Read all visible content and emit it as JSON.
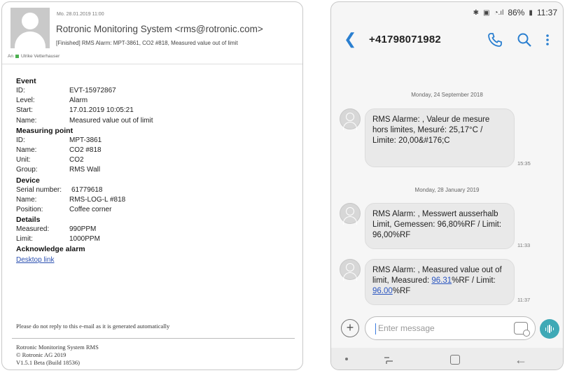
{
  "email": {
    "date": "Mo. 28.01.2019 11:00",
    "sender": "Rotronic Monitoring System <rms@rotronic.com>",
    "subject": "[Finished] RMS Alarm: MPT-3861, CO2 #818, Measured value out of limit",
    "to_prefix": "An",
    "to_name": "Ulrike Vetterhauser",
    "sections": [
      {
        "title": "Event",
        "rows": [
          {
            "k": "ID:",
            "v": "EVT-15972867"
          },
          {
            "k": "Level:",
            "v": "Alarm"
          },
          {
            "k": "Start:",
            "v": "17.01.2019 10:05:21"
          },
          {
            "k": "Name:",
            "v": "Measured value out of limit"
          }
        ]
      },
      {
        "title": "Measuring point",
        "rows": [
          {
            "k": "ID:",
            "v": "MPT-3861"
          },
          {
            "k": "Name:",
            "v": "CO2 #818"
          },
          {
            "k": "Unit:",
            "v": "CO2"
          },
          {
            "k": "Group:",
            "v": "RMS Wall"
          }
        ]
      },
      {
        "title": "Device",
        "rows": [
          {
            "k": "Serial number:",
            "v": "61779618"
          },
          {
            "k": "Name:",
            "v": "RMS-LOG-L #818"
          },
          {
            "k": "Position:",
            "v": "Coffee corner"
          }
        ]
      },
      {
        "title": "Details",
        "rows": [
          {
            "k": "Measured:",
            "v": "990PPM"
          },
          {
            "k": "Limit:",
            "v": "1000PPM"
          }
        ]
      }
    ],
    "ack_title": "Acknowledge alarm",
    "ack_link": "Desktop link",
    "noreply": "Please do not reply to this e-mail as it is generated automatically",
    "footer": [
      "Rotronic Monitoring System RMS",
      "© Rotronic AG 2019",
      "V1.5.1 Beta (Build 18536)"
    ]
  },
  "phone": {
    "status": {
      "battery": "86%",
      "time": "11:37"
    },
    "contact": "+41798071982",
    "messages": [
      {
        "date": "Monday, 24 September 2018",
        "text": "RMS Alarme: , Valeur de mesure hors limites, Mesuré: 25,17°C / Limite: 20,00&#176;C",
        "time": "15:35"
      },
      {
        "date": "Monday, 28 January 2019",
        "text": "RMS Alarm: , Messwert ausserhalb Limit, Gemessen: 96,80%RF / Limit: 96,00%RF",
        "time": "11:33"
      },
      {
        "date": "",
        "text_a": "RMS Alarm: , Measured value out of limit, Measured: ",
        "link_a": "96.31",
        "text_b": "%RF / Limit: ",
        "link_b": "96.00",
        "text_c": "%RF",
        "time": "11:37"
      }
    ],
    "composer_placeholder": "Enter message"
  }
}
